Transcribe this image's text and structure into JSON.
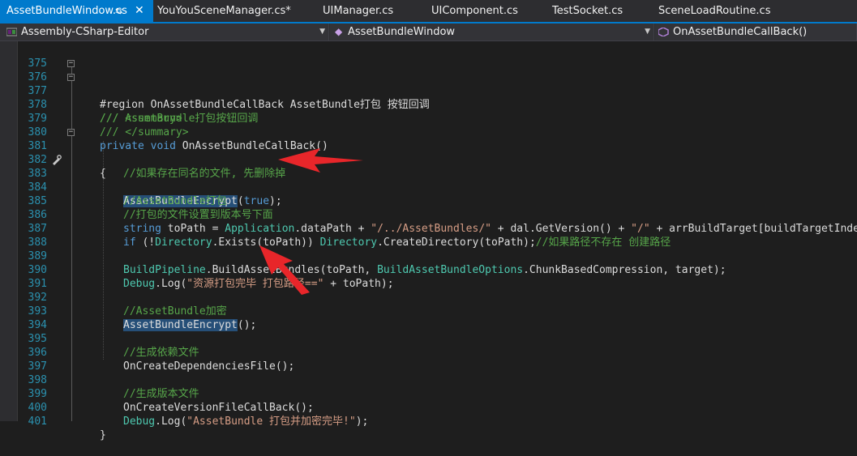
{
  "tabs": [
    {
      "label": "AssetBundleWindow.cs",
      "active": true,
      "pin": "⇆",
      "close": "✕"
    },
    {
      "label": "YouYouSceneManager.cs*"
    },
    {
      "label": "UIManager.cs"
    },
    {
      "label": "UIComponent.cs"
    },
    {
      "label": "TestSocket.cs"
    },
    {
      "label": "SceneLoadRoutine.cs"
    }
  ],
  "navigation": {
    "project": "Assembly-CSharp-Editor",
    "class": "AssetBundleWindow",
    "member": "OnAssetBundleCallBack()"
  },
  "line_numbers": [
    "375",
    "376",
    "377",
    "378",
    "379",
    "380",
    "381",
    "382",
    "383",
    "384",
    "385",
    "386",
    "387",
    "388",
    "389",
    "390",
    "391",
    "392",
    "393",
    "394",
    "395",
    "396",
    "397",
    "398",
    "399",
    "400",
    "401"
  ],
  "code": {
    "l376_region": "#region",
    "l376_name": " OnAssetBundleCallBack AssetBundle打包 按钮回调",
    "l377": "/// <summary>",
    "l378": "/// AssetBundle打包按钮回调",
    "l379": "/// </summary>",
    "l380_private": "private",
    "l380_void": "void",
    "l380_name": " OnAssetBundleCallBack()",
    "l381": "{",
    "l382": "//如果存在同名的文件, 先删除掉",
    "l383_call": "AssetBundleEncrypt",
    "l383_open": "(",
    "l383_true": "true",
    "l383_close": ");",
    "l384": "//AssetBundle打包",
    "l385": "//打包的文件设置到版本号下面",
    "l386_string": "string",
    "l386_var": " toPath = ",
    "l386_app": "Application",
    "l386_mid": ".dataPath + ",
    "l386_str1": "\"/../AssetBundles/\"",
    "l386_mid2": " + dal.GetVersion() + ",
    "l386_str2": "\"/\"",
    "l386_end": " + arrBuildTarget[buildTargetIndex];",
    "l387_if": "if",
    "l387_a": " (!",
    "l387_dir1": "Directory",
    "l387_b": ".Exists(toPath)) ",
    "l387_dir2": "Directory",
    "l387_c": ".CreateDirectory(toPath);",
    "l387_cm": "//如果路径不存在 创建路径",
    "l389_bp": "BuildPipeline",
    "l389_a": ".BuildAssetBundles(toPath, ",
    "l389_opt": "BuildAssetBundleOptions",
    "l389_b": ".ChunkBasedCompression, target);",
    "l390_debug": "Debug",
    "l390_a": ".Log(",
    "l390_str": "\"资源打包完毕 打包路径==\"",
    "l390_b": " + toPath);",
    "l392": "//AssetBundle加密",
    "l393_call": "AssetBundleEncrypt",
    "l393_b": "();",
    "l395": "//生成依赖文件",
    "l396": "OnCreateDependenciesFile();",
    "l398": "//生成版本文件",
    "l399": "OnCreateVersionFileCallBack();",
    "l400_debug": "Debug",
    "l400_a": ".Log(",
    "l400_str": "\"AssetBundle 打包并加密完毕!\"",
    "l400_b": ");",
    "l401": "}"
  },
  "colors": {
    "accent": "#007acc",
    "keyword": "#569cd6",
    "comment": "#57a64a",
    "type": "#4ec9b0",
    "string": "#d69d85",
    "line_number": "#2b91af",
    "selection": "#264f78",
    "annotation_arrow": "#e8262a"
  },
  "icons": {
    "project": "csharp-project-icon",
    "member": "method-icon",
    "bookmark": "pencil-link-icon"
  }
}
